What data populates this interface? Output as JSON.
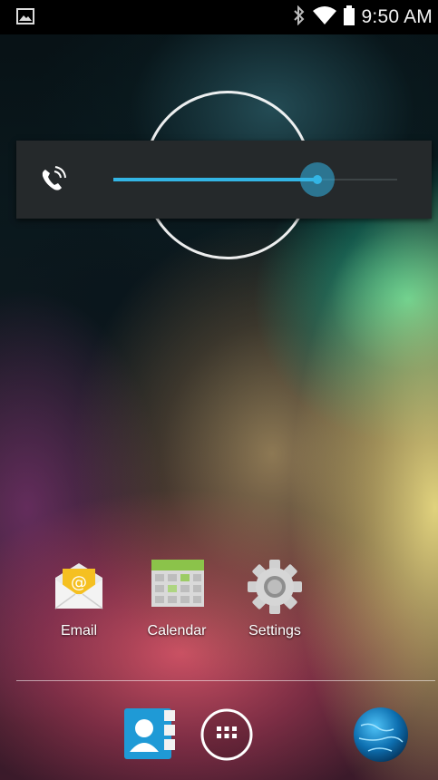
{
  "status_bar": {
    "time": "9:50 AM",
    "left_icon": "picture-icon",
    "right_icons": [
      "bluetooth-icon",
      "wifi-icon",
      "battery-icon"
    ]
  },
  "volume_dialog": {
    "icon": "in-call-volume-icon",
    "level_fraction": 0.72,
    "accent_color": "#33b5e5"
  },
  "home_apps": [
    {
      "label": "Email",
      "icon": "email-icon"
    },
    {
      "label": "Calendar",
      "icon": "calendar-icon"
    },
    {
      "label": "Settings",
      "icon": "settings-gear-icon"
    }
  ],
  "dock": {
    "items": [
      "contacts-icon",
      "all-apps-icon",
      "browser-globe-icon"
    ]
  }
}
